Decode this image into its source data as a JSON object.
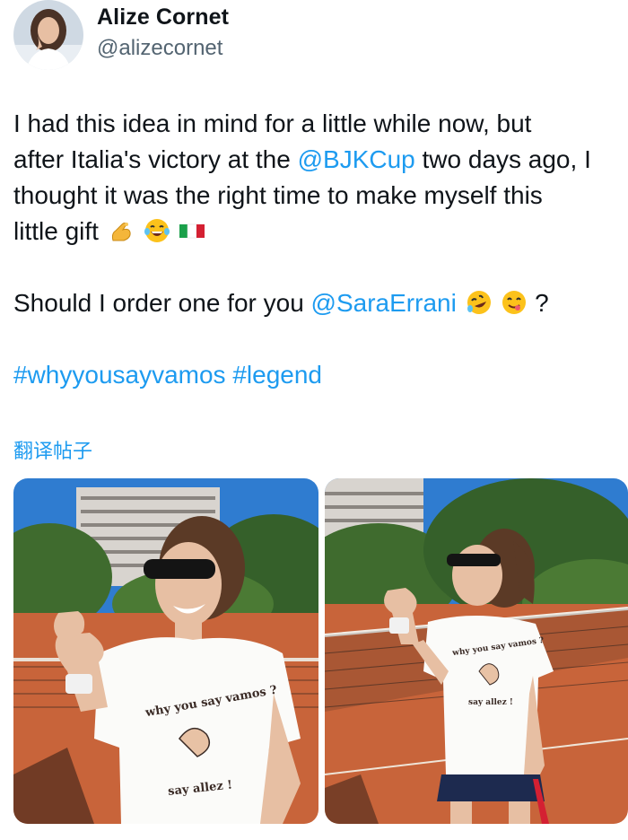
{
  "author": {
    "name": "Alize Cornet",
    "handle": "@alizecornet"
  },
  "tweet": {
    "p1_l1": "I had this idea in mind for a little while now, but",
    "p1_l2_pre": "after Italia's victory at the ",
    "p1_l2_link": "@BJKCup",
    "p1_l2_post": " two days ago, I",
    "p1_l3": "thought it was the right time to make myself this",
    "p1_l4": "little gift",
    "p2_pre": "Should I order one for you ",
    "p2_link": "@SaraErrani",
    "p2_post": "?",
    "hashtag1": "#whyyousayvamos",
    "hashtag2": "#legend"
  },
  "translate_label": "翻译帖子",
  "icons": {
    "gesture": "pinched-fingers-emoji",
    "laugh": "face-with-tears-of-joy-emoji",
    "flag": "italy-flag-emoji",
    "rofl": "rolling-on-floor-laughing-emoji",
    "yum": "face-savoring-food-emoji"
  },
  "photos": {
    "left": {
      "shirt_line1": "why you say vamos ?",
      "shirt_line2": "say allez !"
    },
    "right": {
      "shirt_line1": "why you say vamos ?",
      "shirt_line2": "say allez !"
    }
  },
  "colors": {
    "link": "#1d9bf0",
    "muted": "#536471",
    "text": "#0f1419",
    "clay": "#c8643a"
  }
}
